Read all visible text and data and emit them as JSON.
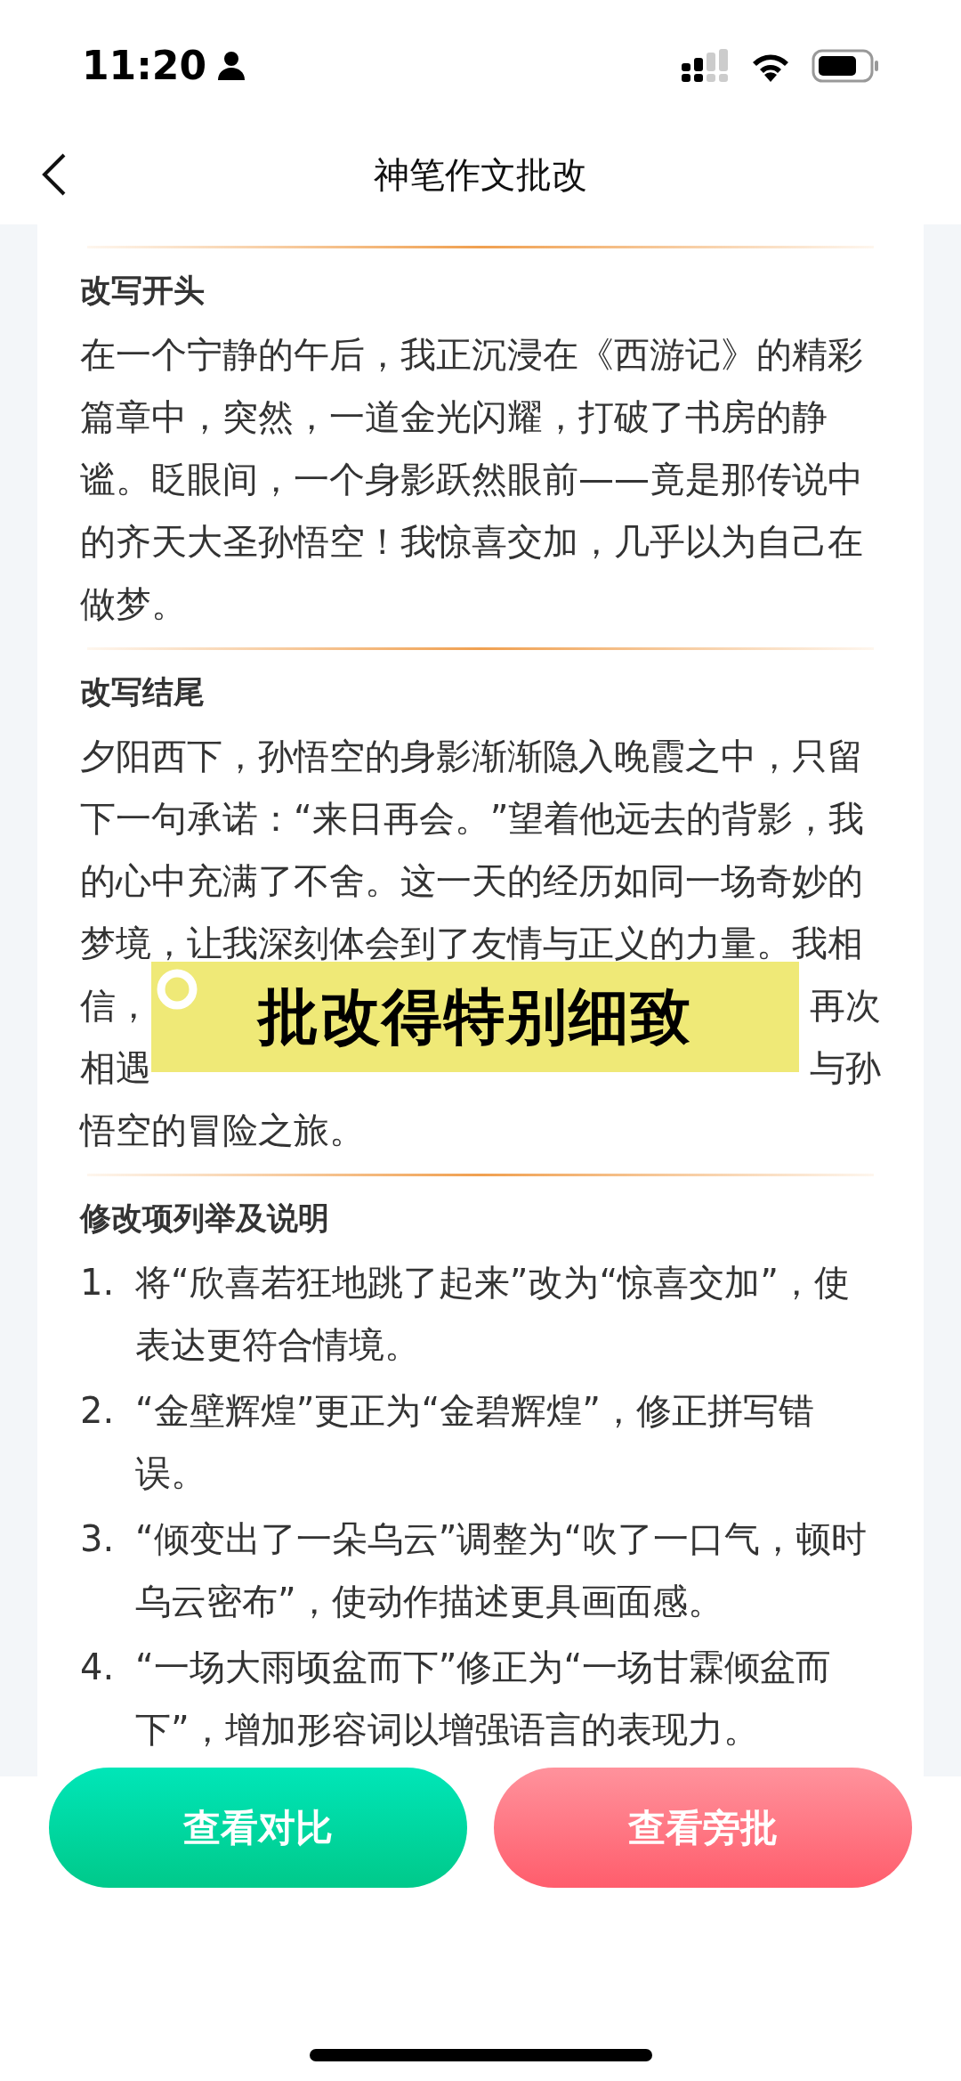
{
  "status_bar": {
    "time": "11:20"
  },
  "header": {
    "title": "神笔作文批改"
  },
  "sections": [
    {
      "kind": "paragraph",
      "heading": "改写开头",
      "lines": [
        {
          "parts": [
            "在一个宁静的午后，我正沉浸在《西游记》的精彩"
          ]
        },
        {
          "parts": [
            "篇章中，突然，一道金光闪耀，打破了书房的静"
          ]
        },
        {
          "parts": [
            "谧。眨眼间，一个身影跃然眼前——竟是那传说中"
          ]
        },
        {
          "parts": [
            "的齐天大圣孙悟空！我惊喜交加，几乎以为自己在"
          ]
        },
        {
          "parts": [
            "做梦。"
          ]
        }
      ]
    },
    {
      "kind": "paragraph",
      "heading": "改写结尾",
      "caption": "批改得特别细致",
      "lines": [
        {
          "parts": [
            "夕阳西下，孙悟空的身影渐渐隐入晚霞之中，只留"
          ]
        },
        {
          "parts": [
            "下一句承诺：“来日再会。”望着他远去的背影，我"
          ]
        },
        {
          "parts": [
            "的心中充满了不舍。这一天的经历如同一场奇妙的"
          ]
        },
        {
          "parts": [
            "梦境，让我深刻体会到了友情与正义的力量。我相"
          ]
        },
        {
          "parts": [
            "信，",
            "再次"
          ]
        },
        {
          "parts": [
            "相遇",
            "与孙"
          ]
        },
        {
          "parts": [
            "悟空的冒险之旅。"
          ]
        }
      ]
    },
    {
      "kind": "list",
      "heading": "修改项列举及说明",
      "items": [
        {
          "number": "1.",
          "text": "将“欣喜若狂地跳了起来”改为“惊喜交加”，使表达更符合情境。"
        },
        {
          "number": "2.",
          "text": "“金壁辉煌”更正为“金碧辉煌”，修正拼写错误。"
        },
        {
          "number": "3.",
          "text": "“倾变出了一朵乌云”调整为“吹了一口气，顿时乌云密布”，使动作描述更具画面感。"
        },
        {
          "number": "4.",
          "text": "“一场大雨顷盆而下”修正为“一场甘霖倾盆而下”，增加形容词以增强语言的表现力。"
        }
      ]
    }
  ],
  "buttons": [
    {
      "label": "查看对比",
      "kind": "green"
    },
    {
      "label": "查看旁批",
      "kind": "red"
    }
  ]
}
